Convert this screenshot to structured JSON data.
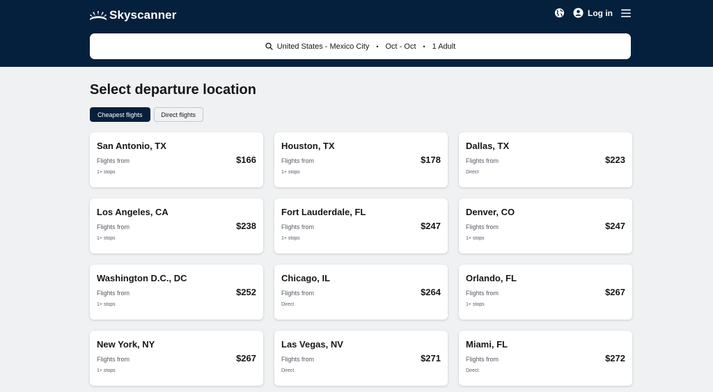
{
  "header": {
    "brand": "Skyscanner",
    "login_label": "Log in",
    "icons": [
      "region-globe-icon",
      "account-circle-icon",
      "menu-icon"
    ]
  },
  "search": {
    "route": "United States - Mexico City",
    "dates": "Oct - Oct",
    "travellers": "1 Adult",
    "separator": "•"
  },
  "page": {
    "title": "Select departure location"
  },
  "filters": [
    {
      "label": "Cheapest flights",
      "active": true
    },
    {
      "label": "Direct flights",
      "active": false
    }
  ],
  "cards": [
    {
      "city": "San Antonio, TX",
      "from_label": "Flights from",
      "price": "$166",
      "stops": "1+ stops"
    },
    {
      "city": "Houston, TX",
      "from_label": "Flights from",
      "price": "$178",
      "stops": "1+ stops"
    },
    {
      "city": "Dallas, TX",
      "from_label": "Flights from",
      "price": "$223",
      "stops": "Direct"
    },
    {
      "city": "Los Angeles, CA",
      "from_label": "Flights from",
      "price": "$238",
      "stops": "1+ stops"
    },
    {
      "city": "Fort Lauderdale, FL",
      "from_label": "Flights from",
      "price": "$247",
      "stops": "1+ stops"
    },
    {
      "city": "Denver, CO",
      "from_label": "Flights from",
      "price": "$247",
      "stops": "1+ stops"
    },
    {
      "city": "Washington D.C., DC",
      "from_label": "Flights from",
      "price": "$252",
      "stops": "1+ stops"
    },
    {
      "city": "Chicago, IL",
      "from_label": "Flights from",
      "price": "$264",
      "stops": "Direct"
    },
    {
      "city": "Orlando, FL",
      "from_label": "Flights from",
      "price": "$267",
      "stops": "1+ stops"
    },
    {
      "city": "New York, NY",
      "from_label": "Flights from",
      "price": "$267",
      "stops": "1+ stops"
    },
    {
      "city": "Las Vegas, NV",
      "from_label": "Flights from",
      "price": "$271",
      "stops": "Direct"
    },
    {
      "city": "Miami, FL",
      "from_label": "Flights from",
      "price": "$272",
      "stops": "Direct"
    }
  ],
  "colors": {
    "brand_navy": "#05203c",
    "page_bg": "#eff1f2",
    "card_bg": "#ffffff",
    "text": "#161616",
    "muted_text": "#545860"
  }
}
